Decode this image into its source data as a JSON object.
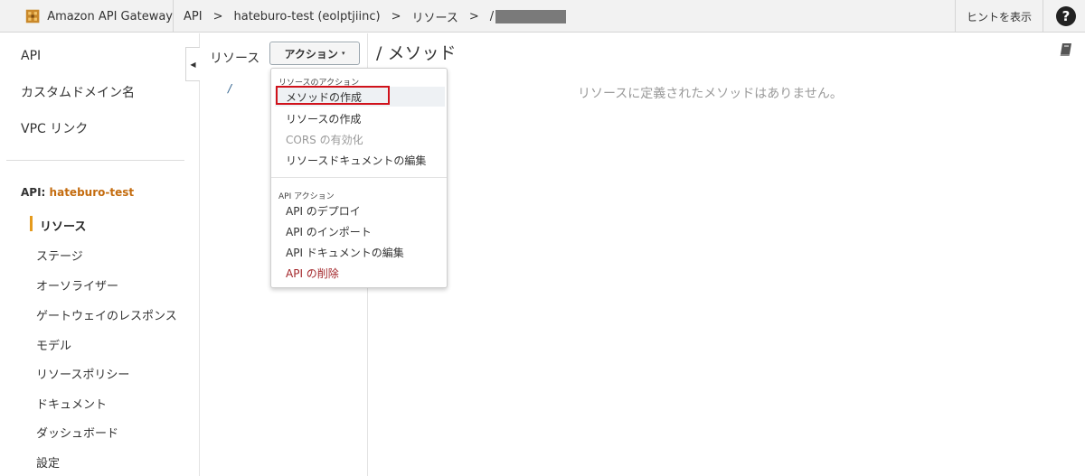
{
  "topbar": {
    "brand": "Amazon API Gateway",
    "breadcrumb": [
      "API",
      "hateburo-test (eolptjiinc)",
      "リソース",
      "/"
    ],
    "separator": ">",
    "hint_button": "ヒントを表示",
    "help_icon": "?"
  },
  "leftnav": {
    "top_items": [
      "API",
      "カスタムドメイン名",
      "VPC リンク"
    ],
    "api_prefix": "API:",
    "api_name": "hateburo-test",
    "sub_items": [
      "リソース",
      "ステージ",
      "オーソライザー",
      "ゲートウェイのレスポンス",
      "モデル",
      "リソースポリシー",
      "ドキュメント",
      "ダッシュボード",
      "設定"
    ],
    "active_item": "リソース",
    "collapse_icon": "◀"
  },
  "resources": {
    "label": "リソース",
    "action_button": "アクション",
    "caret": "▾",
    "root": "/"
  },
  "methods": {
    "title": "/ メソッド",
    "empty_message": "リソースに定義されたメソッドはありません。"
  },
  "dropdown": {
    "resource_header": "リソースのアクション",
    "resource_items": [
      "メソッドの作成",
      "リソースの作成",
      "CORS の有効化",
      "リソースドキュメントの編集"
    ],
    "api_header": "API アクション",
    "api_items": [
      "API のデプロイ",
      "API のインポート",
      "API ドキュメントの編集",
      "API の削除"
    ]
  },
  "colors": {
    "brand_accent": "#e59b1d",
    "api_name": "#c46c0f",
    "highlight_box": "#d0121b",
    "danger": "#a3262a"
  }
}
